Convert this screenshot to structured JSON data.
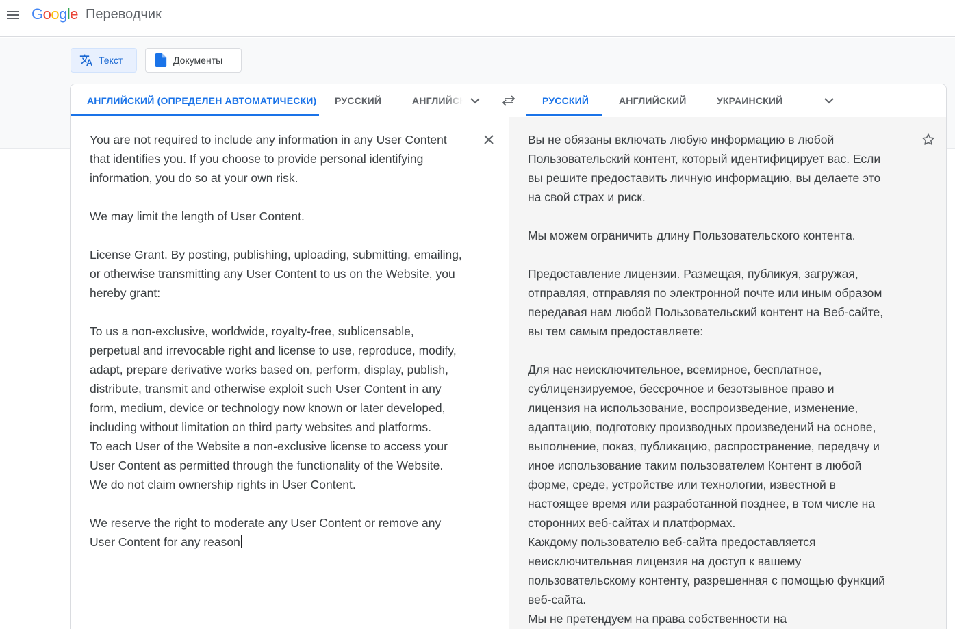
{
  "header": {
    "logo": "Google",
    "app_title": "Переводчик",
    "menu_icon": "hamburger-menu-icon"
  },
  "modes": [
    {
      "label": "Текст",
      "icon": "translate-icon",
      "active": true
    },
    {
      "label": "Документы",
      "icon": "document-icon",
      "active": false
    }
  ],
  "source_langs": [
    {
      "label": "АНГЛИЙСКИЙ (ОПРЕДЕЛЕН АВТОМАТИЧЕСКИ)",
      "active": true
    },
    {
      "label": "РУССКИЙ",
      "active": false
    },
    {
      "label": "АНГЛИЙСКИЙ",
      "active": false
    }
  ],
  "target_langs": [
    {
      "label": "РУССКИЙ",
      "active": true
    },
    {
      "label": "АНГЛИЙСКИЙ",
      "active": false
    },
    {
      "label": "УКРАИНСКИЙ",
      "active": false
    }
  ],
  "source": {
    "lines": [
      [
        "You are not required to include any information in any User Content",
        "that identifies you. If you choose to provide personal identifying",
        "information, you do so at your own risk."
      ],
      [
        "We may limit the length of User Content."
      ],
      [
        "License Grant. By posting, publishing, uploading, submitting, emailing,",
        "or otherwise transmitting any User Content to us on the Website, you",
        "hereby grant:"
      ],
      [
        "To us a non-exclusive, worldwide, royalty-free, sublicensable,",
        "perpetual and irrevocable right and license to use, reproduce, modify,",
        "adapt, prepare derivative works based on, perform, display, publish,",
        "distribute, transmit and otherwise exploit such User Content in any",
        "form, medium, device or technology now known or later developed,",
        "including without limitation on third party websites and platforms.",
        "To each User of the Website a non-exclusive license to access your",
        "User Content as permitted through the functionality of the Website.",
        "We do not claim ownership rights in User Content."
      ],
      [
        "We reserve the right to moderate any User Content or remove any",
        "User Content for any reason"
      ]
    ]
  },
  "target": {
    "lines": [
      [
        "Вы не обязаны включать любую информацию в любой",
        "Пользовательский контент, который идентифицирует вас. Если",
        "вы решите предоставить личную информацию, вы делаете это",
        "на свой страх и риск."
      ],
      [
        "Мы можем ограничить длину Пользовательского контента."
      ],
      [
        "Предоставление лицензии. Размещая, публикуя, загружая,",
        "отправляя, отправляя по электронной почте или иным образом",
        "передавая нам любой Пользовательский контент на Веб-сайте,",
        "вы тем самым предоставляете:"
      ],
      [
        "Для нас неисключительное, всемирное, бесплатное,",
        "сублицензируемое, бессрочное и безотзывное право и",
        "лицензия на использование, воспроизведение, изменение,",
        "адаптацию, подготовку производных произведений на основе,",
        "выполнение, показ, публикацию, распространение, передачу и",
        "иное использование таким пользователем Контент в любой",
        "форме, среде, устройстве или технологии, известной в",
        "настоящее время или разработанной позднее, в том числе на",
        "сторонних веб-сайтах и платформах.",
        "Каждому пользователю веб-сайта предоставляется",
        "неисключительная лицензия на доступ к вашему",
        "пользовательскому контенту, разрешенная с помощью функций",
        "веб-сайта.",
        "Мы не претендуем на права собственности на"
      ]
    ]
  },
  "colors": {
    "accent": "#1a73e8",
    "active_mode_bg": "#e8f0fe",
    "target_bg": "#f5f5f5"
  }
}
